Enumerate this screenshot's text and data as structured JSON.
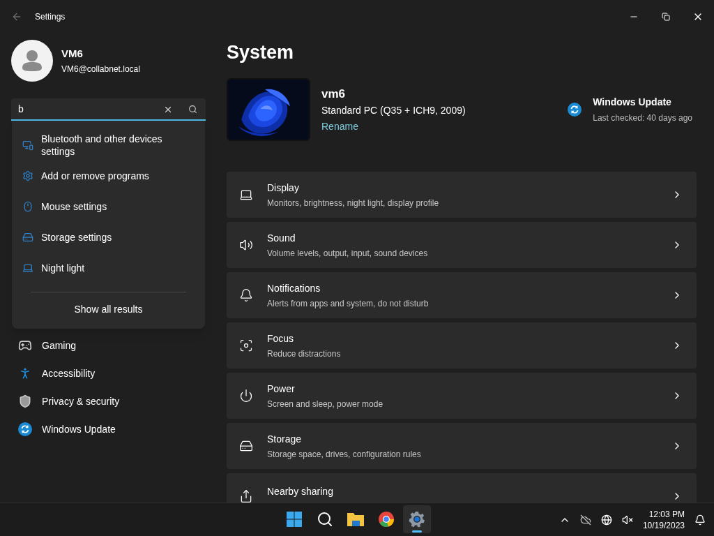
{
  "window": {
    "title": "Settings"
  },
  "profile": {
    "name": "VM6",
    "email": "VM6@collabnet.local"
  },
  "search": {
    "value": "b"
  },
  "search_results": {
    "items": [
      {
        "label": "Bluetooth and other devices settings",
        "kind": "devices"
      },
      {
        "label": "Add or remove programs",
        "kind": "gear"
      },
      {
        "label": "Mouse settings",
        "kind": "mouse"
      },
      {
        "label": "Storage settings",
        "kind": "storage"
      },
      {
        "label": "Night light",
        "kind": "laptop"
      }
    ],
    "show_all": "Show all results"
  },
  "nav": [
    {
      "label": "Gaming",
      "kind": "gaming"
    },
    {
      "label": "Accessibility",
      "kind": "accessibility"
    },
    {
      "label": "Privacy & security",
      "kind": "privacy"
    },
    {
      "label": "Windows Update",
      "kind": "update"
    }
  ],
  "page_title": "System",
  "device": {
    "name": "vm6",
    "model": "Standard PC (Q35 + ICH9, 2009)",
    "rename": "Rename"
  },
  "update": {
    "title": "Windows Update",
    "status": "Last checked: 40 days ago"
  },
  "settings": [
    {
      "title": "Display",
      "subtitle": "Monitors, brightness, night light, display profile",
      "kind": "display"
    },
    {
      "title": "Sound",
      "subtitle": "Volume levels, output, input, sound devices",
      "kind": "sound"
    },
    {
      "title": "Notifications",
      "subtitle": "Alerts from apps and system, do not disturb",
      "kind": "notifications"
    },
    {
      "title": "Focus",
      "subtitle": "Reduce distractions",
      "kind": "focus"
    },
    {
      "title": "Power",
      "subtitle": "Screen and sleep, power mode",
      "kind": "power"
    },
    {
      "title": "Storage",
      "subtitle": "Storage space, drives, configuration rules",
      "kind": "storage"
    },
    {
      "title": "Nearby sharing",
      "kind": "sharing"
    }
  ],
  "taskbar": {
    "apps": [
      {
        "kind": "start",
        "selected": false
      },
      {
        "kind": "search",
        "selected": false
      },
      {
        "kind": "files",
        "selected": false
      },
      {
        "kind": "browser",
        "selected": false
      },
      {
        "kind": "settings",
        "selected": true
      }
    ],
    "time": "12:03 PM",
    "date": "10/19/2023"
  }
}
